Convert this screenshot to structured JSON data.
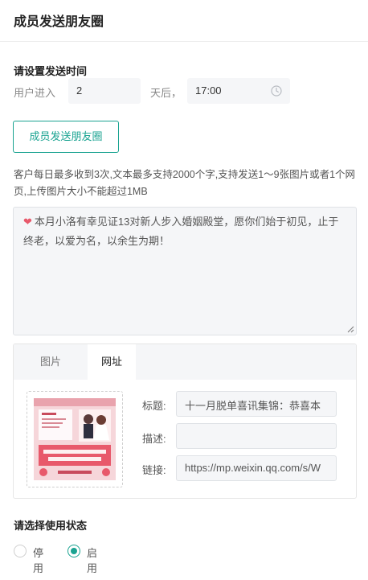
{
  "header": {
    "title": "成员发送朋友圈"
  },
  "time_section": {
    "label": "请设置发送时间",
    "prefix": "用户进入",
    "days_value": "2",
    "suffix": "天后，",
    "time_value": "17:00"
  },
  "send_button_label": "成员发送朋友圈",
  "notice": "客户每日最多收到3次,文本最多支持2000个字,支持发送1～9张图片或者1个网页,上传图片大小不能超过1MB",
  "message": {
    "emoji": "❤",
    "text": "本月小洛有幸见证13对新人步入婚姻殿堂，愿你们始于初见，止于终老，以爱为名，以余生为期！"
  },
  "link_card": {
    "tabs": [
      {
        "label": "图片",
        "active": false
      },
      {
        "label": "网址",
        "active": true
      }
    ],
    "thumbnail_icon": "wedding-poster-image",
    "fields": {
      "title_label": "标题:",
      "title_value": "十一月脱单喜讯集锦：恭喜本",
      "desc_label": "描述:",
      "desc_value": "",
      "link_label": "链接:",
      "link_value": "https://mp.weixin.qq.com/s/W"
    }
  },
  "status_section": {
    "label": "请选择使用状态",
    "options": [
      {
        "label": "停用",
        "selected": false
      },
      {
        "label": "启用",
        "selected": true
      }
    ]
  },
  "colors": {
    "accent": "#1aa391",
    "heart": "#e8596b",
    "field_bg": "#f5f6f8"
  }
}
